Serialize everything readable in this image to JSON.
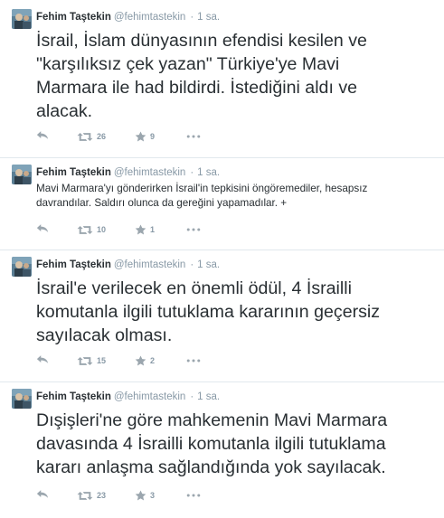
{
  "colors": {
    "text": "#292f33",
    "meta": "#8899a6",
    "icon": "#9ba6ae",
    "divider": "#e1e8ed"
  },
  "icons": {
    "reply": "reply-icon",
    "retweet": "retweet-icon",
    "favorite": "star-icon",
    "more": "more-icon"
  },
  "tweets": [
    {
      "name": "Fehim Taştekin",
      "handle": "@fehimtastekin",
      "separator": "·",
      "time": "1 sa.",
      "text": "İsrail, İslam dünyasının efendisi kesilen ve\n\"karşılıksız çek yazan\" Türkiye'ye Mavi\nMarmara ile had bildirdi. İstediğini aldı ve\nalacak.",
      "retweets": "26",
      "favorites": "9"
    },
    {
      "name": "Fehim Taştekin",
      "handle": "@fehimtastekin",
      "separator": "·",
      "time": "1 sa.",
      "text": "Mavi Marmara'yı gönderirken İsrail'in tepkisini öngöremediler, hesapsız\ndavrandılar. Saldırı olunca da gereğini yapamadılar. +",
      "retweets": "10",
      "favorites": "1"
    },
    {
      "name": "Fehim Taştekin",
      "handle": "@fehimtastekin",
      "separator": "·",
      "time": "1 sa.",
      "text": "İsrail'e verilecek en önemli ödül, 4 İsrailli\nkomutanla ilgili tutuklama kararının geçersiz\nsayılacak olması.",
      "retweets": "15",
      "favorites": "2"
    },
    {
      "name": "Fehim Taştekin",
      "handle": "@fehimtastekin",
      "separator": "·",
      "time": "1 sa.",
      "text": "Dışişleri'ne göre mahkemenin Mavi Marmara\ndavasında 4 İsrailli komutanla ilgili tutuklama\nkararı anlaşma sağlandığında yok sayılacak.",
      "retweets": "23",
      "favorites": "3"
    }
  ]
}
